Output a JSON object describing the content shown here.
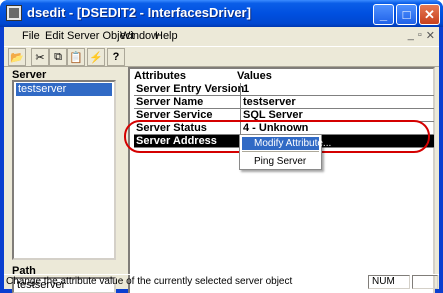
{
  "window": {
    "title": "dsedit - [DSEDIT2 - InterfacesDriver]",
    "minimize_icon": "minimize-icon",
    "maximize_icon": "maximize-icon",
    "close_icon": "close-icon"
  },
  "menubar": {
    "items": [
      "File",
      "Edit",
      "Server Object",
      "Window",
      "Help"
    ],
    "mdi_controls": [
      "_",
      "▫",
      "✕"
    ]
  },
  "toolbar": {
    "tools": [
      {
        "icon": "open-folder-icon",
        "glyph": "📂"
      },
      {
        "icon": "cut-icon",
        "glyph": "✂"
      },
      {
        "icon": "copy-icon",
        "glyph": "⧉"
      },
      {
        "icon": "paste-icon",
        "glyph": "📋"
      },
      {
        "icon": "lightning-icon",
        "glyph": "⚡"
      },
      {
        "icon": "help-icon",
        "glyph": "?"
      }
    ]
  },
  "server_pane": {
    "label": "Server",
    "items": [
      "testserver"
    ]
  },
  "path_pane": {
    "label": "Path",
    "value": "testserver"
  },
  "attributes": {
    "col_attr": "Attributes",
    "col_values": "Values",
    "rows": [
      {
        "key": "Server Entry Version",
        "value": "1"
      },
      {
        "key": "Server Name",
        "value": "testserver"
      },
      {
        "key": "Server Service",
        "value": "SQL Server"
      },
      {
        "key": "Server Status",
        "value": "4 - Unknown"
      },
      {
        "key": "Server Address",
        "value": ""
      }
    ]
  },
  "context_menu": {
    "items": [
      "Modify Attribute...",
      "Ping Server"
    ]
  },
  "statusbar": {
    "text": "Change the attribute value of the currently selected server object",
    "num": "NUM"
  },
  "colors": {
    "selection": "#316ac5",
    "highlight_oval": "#d40000"
  }
}
